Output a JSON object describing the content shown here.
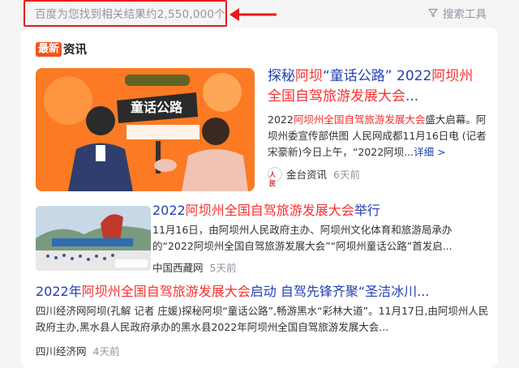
{
  "result_count": "百度为您找到相关结果约2,550,000个",
  "search_tools": "搜索工具",
  "colors": {
    "annotation": "#e51c1c",
    "link": "#2440b3",
    "highlight": "#f73131",
    "badge": "#f4511e"
  },
  "news": {
    "badge": "最新",
    "label": "资讯",
    "articles": [
      {
        "title_parts": [
          "探秘",
          "阿坝",
          "“童话公路” 2022",
          "阿坝州",
          "全国自驾旅游发展大会",
          "..."
        ],
        "summary_parts": [
          "2022",
          "阿坝州全国自驾旅游发展大会",
          "盛大启幕。阿坝州委宣传部供图 人民网成都11月16日电 (记者宋豪新)今日上午，“2022阿坝...",
          "详细 >"
        ],
        "source": "金台资讯",
        "source_logo_text": "人民",
        "time": "6天前",
        "image_sign": "童话公路"
      },
      {
        "title_parts": [
          "2022",
          "阿坝州全国自驾旅游发展大会",
          "举行"
        ],
        "summary": "11月16日，由阿坝州人民政府主办、阿坝州文化体育和旅游局承办的“2022阿坝州全国自驾旅游发展大会”“阿坝州童话公路”首发启...",
        "source": "中国西藏网",
        "time": "5天前"
      },
      {
        "title_parts": [
          "2022年",
          "阿坝州全国自驾旅游发展大会",
          "启动 自驾先锋齐聚“圣洁冰川..."
        ],
        "summary": "四川经济网阿坝(孔解 记者 庄媛)探秘阿坝“童话公路”,畅游黑水“彩林大道”。11月17日,由阿坝州人民政府主办,黑水县人民政府承办的黑水县2022年阿坝州全国自驾旅游发展大会...",
        "source": "四川经济网",
        "time": "4天前"
      }
    ]
  }
}
